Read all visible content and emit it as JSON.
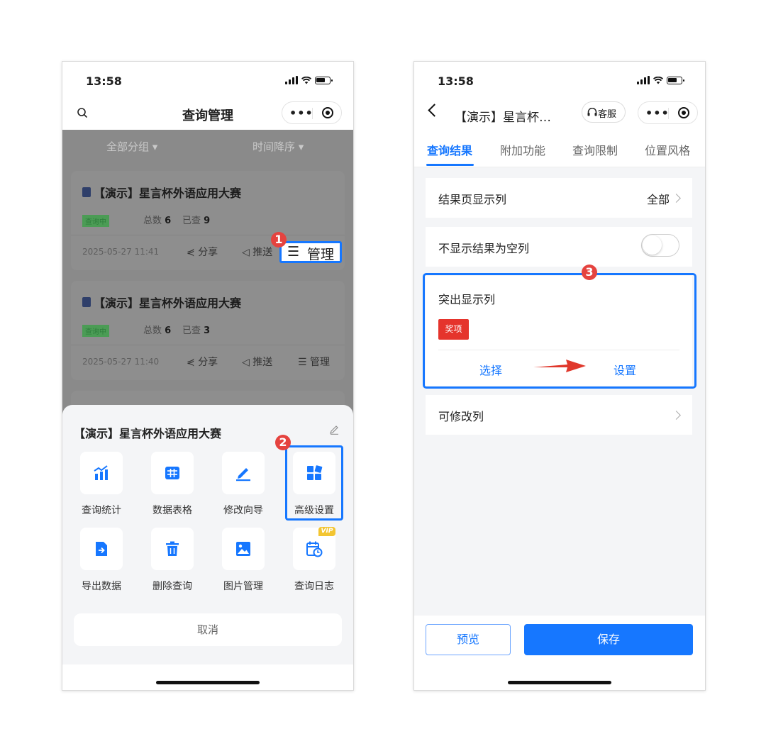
{
  "phone1": {
    "status_time": "13:58",
    "nav_title": "查询管理",
    "capsule_dots": "•••",
    "filters": [
      "全部分组 ▾",
      "时间降序 ▾"
    ],
    "cards": [
      {
        "title": "【演示】星言杯外语应用大赛",
        "badge": "查询中",
        "total_label": "总数",
        "total": "6",
        "checked_label": "已查",
        "checked": "9",
        "date": "2025-05-27 11:41",
        "share": "分享",
        "push": "推送",
        "manage": "管理"
      },
      {
        "title": "【演示】星言杯外语应用大赛",
        "badge": "查询中",
        "total_label": "总数",
        "total": "6",
        "checked_label": "已查",
        "checked": "3",
        "date": "2025-05-27 11:40",
        "share": "分享",
        "push": "推送",
        "manage": "管理"
      }
    ],
    "sheet": {
      "title": "【演示】星言杯外语应用大赛",
      "items": [
        "查询统计",
        "数据表格",
        "修改向导",
        "高级设置",
        "导出数据",
        "删除查询",
        "图片管理",
        "查询日志"
      ],
      "vip": "VIP",
      "cancel": "取消"
    },
    "step1": "1",
    "step2": "2"
  },
  "phone2": {
    "status_time": "13:58",
    "nav_title": "【演示】星言杯…",
    "service_label": "客服",
    "capsule_dots": "•••",
    "tabs": [
      "查询结果",
      "附加功能",
      "查询限制",
      "位置风格"
    ],
    "rows": {
      "result_columns_label": "结果页显示列",
      "result_columns_value": "全部",
      "hide_empty_label": "不显示结果为空列",
      "highlight_label": "突出显示列",
      "highlight_tag": "奖项",
      "select_link": "选择",
      "setup_link": "设置",
      "editable_label": "可修改列"
    },
    "preview_btn": "预览",
    "save_btn": "保存",
    "step3": "3"
  },
  "colors": {
    "accent": "#1677ff",
    "step_badge": "#e5433f",
    "tag_red": "#e5342c",
    "vip": "#f3c531"
  }
}
